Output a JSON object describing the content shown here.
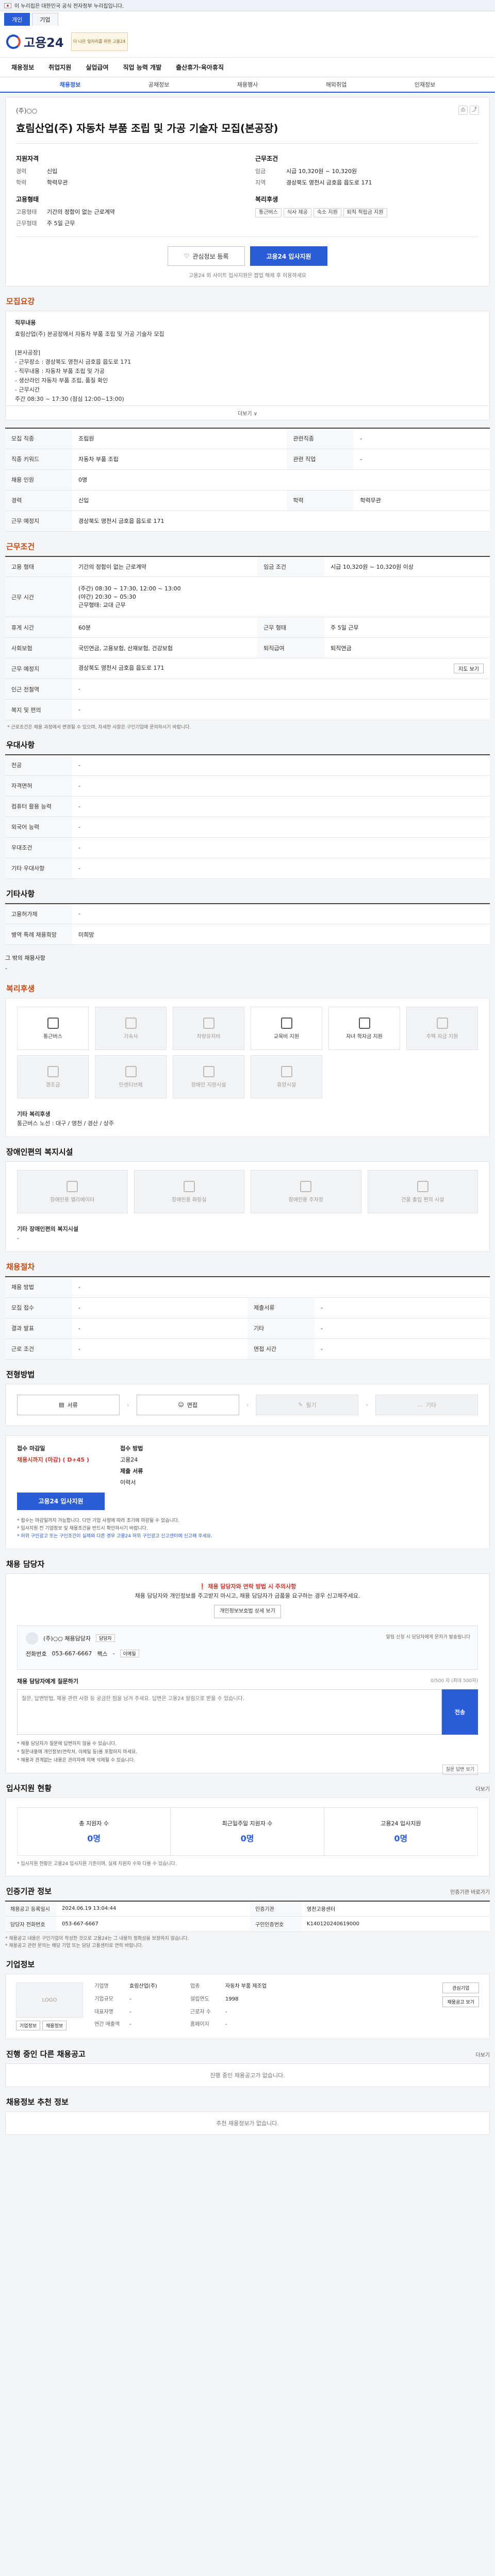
{
  "notice": {
    "text": "이 누리집은 대한민국 공식 전자정부 누리집입니다."
  },
  "top_tabs": [
    "개인",
    "기업"
  ],
  "brand": {
    "name": "고용24",
    "banner": "더 나은 일자리를 위한 고용24"
  },
  "main_nav": [
    "채용정보",
    "취업지원",
    "실업급여",
    "직업 능력 개발",
    "출산휴가·육아휴직"
  ],
  "sub_nav": [
    "채용정보",
    "공채정보",
    "채용행사",
    "해외취업",
    "인재정보"
  ],
  "job": {
    "company": "(주)○○",
    "title": "효림산업(주) 자동차 부품 조립 및 가공 기술자 모집(본공장)",
    "left_head": "지원자격",
    "left": [
      {
        "k": "경력",
        "v": "신입"
      },
      {
        "k": "학력",
        "v": "학력무관"
      },
      {
        "k": "고용형태",
        "v": "기간의 정함이 없는 근로계약"
      },
      {
        "k": "근무형태",
        "v": "주 5일 근무"
      }
    ],
    "right_head": "근무조건",
    "right": [
      {
        "k": "임금",
        "v": "시급 10,320원 ~ 10,320원"
      },
      {
        "k": "지역",
        "v": "경상북도 영천시 금호읍 읍도로 171"
      }
    ],
    "welfare_head": "복리후생",
    "welfare_chips": [
      "통근버스",
      "식사 제공",
      "숙소 지원",
      "퇴직 적립금 지원"
    ],
    "save_label": "관심정보 등록",
    "apply_label": "고용24 입사지원",
    "cta_note": "고용24 외 사이트 입사지원은 팝업 해제 후 이용하세요"
  },
  "recruit": {
    "title": "모집요강",
    "desc_title": "직무내용",
    "desc": "효림산업(주) 본공장에서 자동차 부품 조립 및 가공 기술자 모집\n\n[본사공장]\n- 근무장소 : 경상북도 영천시 금호읍 읍도로 171\n- 직무내용 : 자동차 부품 조립 및 가공\n   - 생산라인 자동차 부품 조립, 품질 확인\n- 근무시간\n   주간 08:30 ~ 17:30 (점심 12:00~13:00)\n   야간 20:30 ~ 05:30",
    "more_label": "더보기 ∨",
    "rows": [
      {
        "k": "모집 직종",
        "v": "조립원",
        "k2": "관련직종",
        "v2": "-"
      },
      {
        "k": "직종 키워드",
        "v": "자동차 부품 조립",
        "k2": "관련 직업",
        "v2": "-"
      },
      {
        "k": "채용 인원",
        "v": "0명",
        "k2": "",
        "v2": ""
      },
      {
        "k": "경력",
        "v": "신입",
        "k2": "학력",
        "v2": "학력무관"
      },
      {
        "k": "근무 예정지",
        "v": "경상북도 영천시 금호읍 읍도로 171",
        "k2": "",
        "v2": ""
      }
    ]
  },
  "conditions": {
    "title": "근무조건",
    "rows": [
      {
        "k": "고용 형태",
        "v": "기간의 정함이 없는 근로계약",
        "k2": "임금 조건",
        "v2": "시급 10,320원 ~ 10,320원 이상"
      },
      {
        "k": "근무 시간",
        "v": "(주간) 08:30 ~ 17:30, 12:00 ~ 13:00\n(야간) 20:30 ~ 05:30\n근무형태: 교대 근무",
        "k2": "",
        "v2": ""
      },
      {
        "k": "휴게 시간",
        "v": "60분",
        "k2": "근무 형태",
        "v2": "주 5일 근무"
      },
      {
        "k": "사회보험",
        "v": "국민연금, 고용보험, 산재보험, 건강보험",
        "k2": "퇴직급여",
        "v2": "퇴직연금"
      },
      {
        "k": "근무 예정지",
        "v": "경상북도 영천시 금호읍 읍도로 171",
        "k2": "",
        "v2": ""
      },
      {
        "k": "인근 전철역",
        "v": "-",
        "k2": "",
        "v2": ""
      },
      {
        "k": "복지 및 편의",
        "v": "-",
        "k2": "",
        "v2": ""
      }
    ],
    "map_label": "지도 보기",
    "note": "* 근로조건은 채용 과정에서 변경될 수 있으며, 자세한 사항은 구인기업에 문의하시기 바랍니다."
  },
  "preference": {
    "title": "우대사항",
    "rows": [
      {
        "k": "전공",
        "v": "-"
      },
      {
        "k": "자격면허",
        "v": "-"
      },
      {
        "k": "컴퓨터 활용 능력",
        "v": "-"
      },
      {
        "k": "외국어 능력",
        "v": "-"
      },
      {
        "k": "우대조건",
        "v": "-"
      },
      {
        "k": "기타 우대사항",
        "v": "-"
      }
    ]
  },
  "etc": {
    "title": "기타사항",
    "rows": [
      {
        "k": "고용허가제",
        "v": "-"
      },
      {
        "k": "병역 특례 채용희망",
        "v": "미희망"
      }
    ],
    "extra_label": "그 밖의 채용사항",
    "extra_value": "-"
  },
  "welfare": {
    "title": "복리후생",
    "items": [
      {
        "label": "통근버스",
        "on": true
      },
      {
        "label": "기숙사",
        "on": false
      },
      {
        "label": "차량유지비",
        "on": false
      },
      {
        "label": "교육비 지원",
        "on": true
      },
      {
        "label": "자녀 학자금 지원",
        "on": true
      },
      {
        "label": "주택 자금 지원",
        "on": false
      },
      {
        "label": "경조금",
        "on": false
      },
      {
        "label": "인센티브제",
        "on": false
      },
      {
        "label": "장애인 지원시설",
        "on": false
      },
      {
        "label": "휴양시설",
        "on": false
      }
    ],
    "extra_title": "기타 복리후생",
    "extra_text": "통근버스 노선 : 대구 / 영천 / 경산 / 상주"
  },
  "disability": {
    "title": "장애인편의 복지시설",
    "items": [
      "장애인용 엘리베이터",
      "장애인용 화장실",
      "장애인용 주차장",
      "건물 출입 편의 시설"
    ],
    "extra_title": "기타 장애인편의 복지시설",
    "extra_value": "-"
  },
  "process": {
    "title": "채용절차",
    "rows": [
      {
        "k": "채용 방법",
        "v": "-",
        "k2": "",
        "v2": ""
      },
      {
        "k": "모집 접수",
        "v": "-",
        "k2": "제출서류",
        "v2": "-"
      },
      {
        "k": "결과 발표",
        "v": "-",
        "k2": "기타",
        "v2": "-"
      },
      {
        "k": "근로 조건",
        "v": "-",
        "k2": "면접 시간",
        "v2": "-"
      }
    ]
  },
  "steps": {
    "title": "전형방법",
    "items": [
      {
        "label": "서류",
        "on": true
      },
      {
        "label": "면접",
        "on": true
      },
      {
        "label": "필기",
        "on": false
      },
      {
        "label": "기타",
        "on": false
      }
    ]
  },
  "apply": {
    "left_label": "접수 마감일",
    "deadline": "채용시까지 (마감) ( D+45 )",
    "right_label": "접수 방법",
    "method": "고용24",
    "method2_label": "제출 서류",
    "method2": "이력서",
    "button": "고용24 입사지원",
    "notes": [
      "* 접수는 마감일까지 가능합니다. 다만 기업 사정에 따라 조기에 마감될 수 있습니다.",
      "* 입사지원 전 기업정보 및 채용조건을 반드시 확인하시기 바랍니다.",
      "* 허위 구인광고 또는 구인조건이 실제와 다른 경우 고용24 허위 구인광고 신고센터에 신고해 주세요."
    ]
  },
  "manager": {
    "title": "채용 담당자",
    "warn_title": "채용 담당자와 연락 방법 시 주의사항",
    "warn_text": "채용 담당자와 개인정보를 주고받지 마시고, 채용 담당자가 금품을 요구하는 경우 신고해주세요.",
    "warn_link": "개인정보보호법 상세 보기",
    "name": "(주)○○ 채용담당자",
    "tag": "담당자",
    "phone_label": "전화번호",
    "phone": "053-667-6667",
    "fax_label": "팩스",
    "fax": "-",
    "alert": "알림 신청 시 담당자에게 문자가 발송됩니다",
    "email_label": "이메일",
    "inq_title": "채용 담당자에게 질문하기",
    "inq_hint": "0/500 자 (최대 500자)",
    "inq_placeholder": "질문, 답변방법, 채용 관련 사항 등 궁금한 점을 남겨 주세요. 답변은 고용24 알림으로 받을 수 있습니다.",
    "inq_send": "전송",
    "inq_notes": [
      "* 채용 담당자가 질문에 답변하지 않을 수 있습니다.",
      "* 질문내용에 개인정보(연락처, 이메일 등)를 포함하지 마세요.",
      "* 채용과 관계없는 내용은 관리자에 의해 삭제될 수 있습니다."
    ],
    "inq_more": "질문 답변 보기"
  },
  "status": {
    "title": "입사지원 현황",
    "link": "더보기",
    "items": [
      {
        "label": "총 지원자 수",
        "value": "0명"
      },
      {
        "label": "최근일주일 지원자 수",
        "value": "0명"
      },
      {
        "label": "고용24 입사지원",
        "value": "0명"
      }
    ],
    "note": "* 입사지원 현황은 고용24 입사지원 기준이며, 실제 지원자 수와 다를 수 있습니다."
  },
  "posting": {
    "title": "인증기관 정보",
    "link": "인증기관 바로가기",
    "rows": [
      {
        "k": "채용공고 등록일시",
        "v": "2024.06.19 13:04:44",
        "k2": "인증기관",
        "v2": "영천고용센터"
      },
      {
        "k": "담당자 전화번호",
        "v": "053-667-6667",
        "k2": "구인인증번호",
        "v2": "K140120240619000"
      }
    ],
    "notes": [
      "* 채용공고 내용은 구인기업이 작성한 것으로 고용24는 그 내용의 정확성을 보장하지 않습니다.",
      "* 채용공고 관련 문의는 해당 기업 또는 담당 고용센터로 연락 바랍니다."
    ]
  },
  "company": {
    "title": "기업정보",
    "logo_text": "LOGO",
    "btn1": "기업정보",
    "btn2": "채용정보",
    "rows": [
      {
        "k": "기업명",
        "v": "효림산업(주)",
        "k2": "업종",
        "v2": "자동차 부품 제조업"
      },
      {
        "k": "기업규모",
        "v": "-",
        "k2": "설립연도",
        "v2": "1998"
      },
      {
        "k": "대표자명",
        "v": "-",
        "k2": "근로자 수",
        "v2": "-"
      },
      {
        "k": "연간 매출액",
        "v": "-",
        "k2": "홈페이지",
        "v2": "-"
      }
    ],
    "side1": "관심기업",
    "side2": "채용공고 보기"
  },
  "other_jobs": {
    "title": "진행 중인 다른 채용공고",
    "link": "더보기",
    "empty": "진행 중인 채용공고가 없습니다."
  },
  "recommend": {
    "title": "채용정보 추천 정보",
    "empty": "추천 채용정보가 없습니다."
  }
}
